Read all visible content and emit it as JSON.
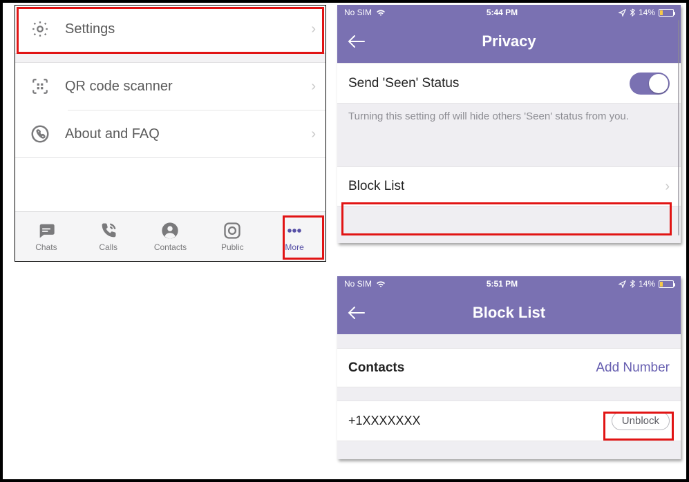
{
  "panel1": {
    "rows": {
      "settings": "Settings",
      "qr": "QR code scanner",
      "about": "About and FAQ"
    },
    "tabs": {
      "chats": "Chats",
      "calls": "Calls",
      "contacts": "Contacts",
      "public": "Public",
      "more": "More"
    }
  },
  "panel2": {
    "status": {
      "carrier": "No SIM",
      "time": "5:44 PM",
      "battery": "14%"
    },
    "title": "Privacy",
    "seen_label": "Send 'Seen' Status",
    "seen_desc": "Turning this setting off will hide others 'Seen' status from you.",
    "blocklist_label": "Block List"
  },
  "panel3": {
    "status": {
      "carrier": "No SIM",
      "time": "5:51 PM",
      "battery": "14%"
    },
    "title": "Block List",
    "section": "Contacts",
    "add_number": "Add Number",
    "blocked_number": "+1XXXXXXX",
    "unblock": "Unblock"
  }
}
